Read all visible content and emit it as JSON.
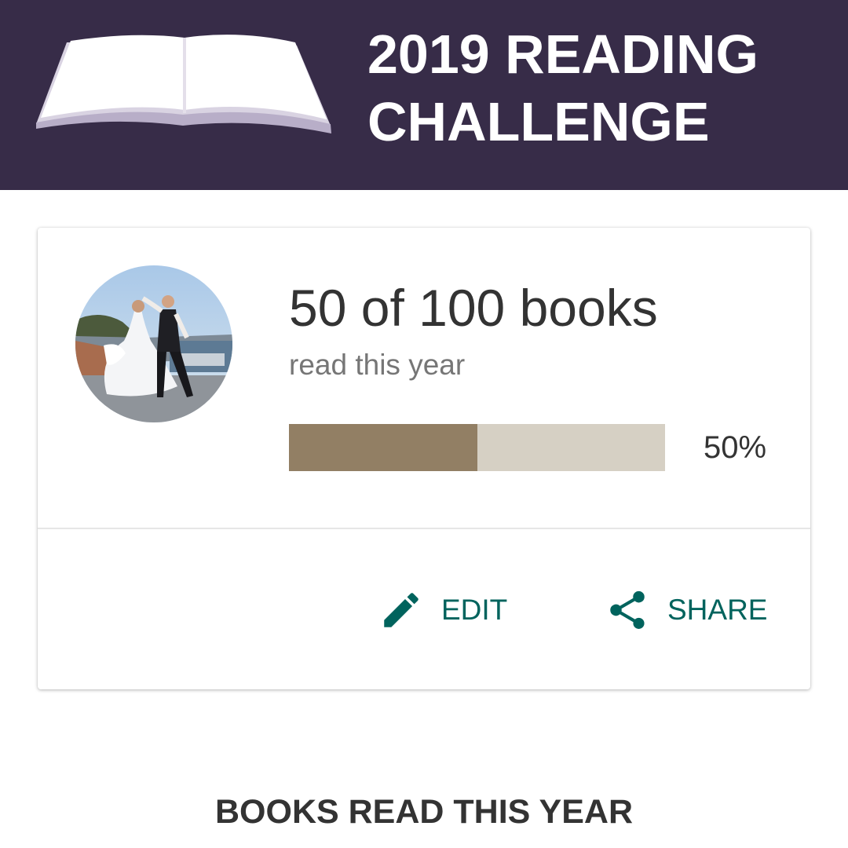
{
  "banner": {
    "title_line1": "2019 READING",
    "title_line2": "CHALLENGE",
    "background_color": "#372c48",
    "logo_icon": "open-book-icon"
  },
  "challenge_card": {
    "avatar_alt": "Profile photo",
    "count_text": "50 of 100 books",
    "subtitle": "read this year",
    "progress": {
      "fraction": 0.5,
      "percent_label": "50%",
      "fill_color": "#927f64",
      "track_color": "#d6d0c4"
    },
    "actions": {
      "edit_label": "EDIT",
      "edit_icon": "pencil-icon",
      "share_label": "SHARE",
      "share_icon": "share-icon",
      "accent_color": "#00635d"
    }
  },
  "books_section": {
    "heading": "BOOKS READ THIS YEAR"
  }
}
